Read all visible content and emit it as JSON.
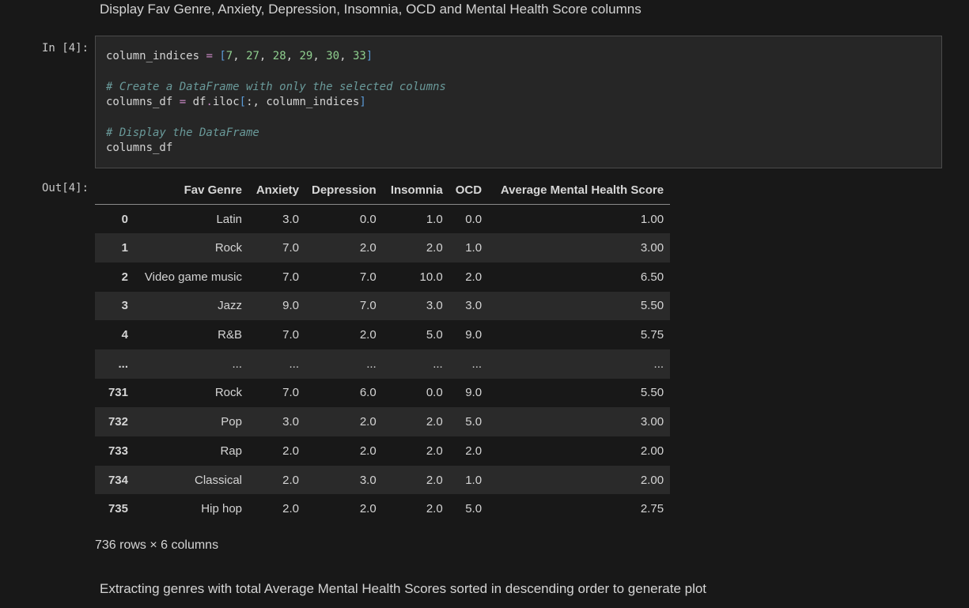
{
  "markdown_top": "Display Fav Genre, Anxiety, Depression, Insomnia, OCD and Mental Health Score columns",
  "in_prompt": "In [4]:",
  "out_prompt": "Out[4]:",
  "code": {
    "line1": {
      "var": "column_indices",
      "op": "=",
      "open": "[",
      "nums": [
        "7",
        "27",
        "28",
        "29",
        "30",
        "33"
      ],
      "sep": ", ",
      "close": "]"
    },
    "line2_comment": "# Create a DataFrame with only the selected columns",
    "line3": {
      "var": "columns_df",
      "op": "=",
      "obj": "df",
      "dot": ".",
      "method": "iloc",
      "open": "[",
      "slice": ":",
      "comma": ", ",
      "arg": "column_indices",
      "close": "]"
    },
    "line4_comment": "# Display the DataFrame",
    "line5": "columns_df"
  },
  "table": {
    "headers": [
      "",
      "Fav Genre",
      "Anxiety",
      "Depression",
      "Insomnia",
      "OCD",
      "Average Mental Health Score"
    ],
    "rows": [
      [
        "0",
        "Latin",
        "3.0",
        "0.0",
        "1.0",
        "0.0",
        "1.00"
      ],
      [
        "1",
        "Rock",
        "7.0",
        "2.0",
        "2.0",
        "1.0",
        "3.00"
      ],
      [
        "2",
        "Video game music",
        "7.0",
        "7.0",
        "10.0",
        "2.0",
        "6.50"
      ],
      [
        "3",
        "Jazz",
        "9.0",
        "7.0",
        "3.0",
        "3.0",
        "5.50"
      ],
      [
        "4",
        "R&B",
        "7.0",
        "2.0",
        "5.0",
        "9.0",
        "5.75"
      ],
      [
        "...",
        "...",
        "...",
        "...",
        "...",
        "...",
        "..."
      ],
      [
        "731",
        "Rock",
        "7.0",
        "6.0",
        "0.0",
        "9.0",
        "5.50"
      ],
      [
        "732",
        "Pop",
        "3.0",
        "2.0",
        "2.0",
        "5.0",
        "3.00"
      ],
      [
        "733",
        "Rap",
        "2.0",
        "2.0",
        "2.0",
        "2.0",
        "2.00"
      ],
      [
        "734",
        "Classical",
        "2.0",
        "3.0",
        "2.0",
        "1.0",
        "2.00"
      ],
      [
        "735",
        "Hip hop",
        "2.0",
        "2.0",
        "2.0",
        "5.0",
        "2.75"
      ]
    ]
  },
  "shape_text": "736 rows × 6 columns",
  "markdown_bottom": "Extracting genres with total Average Mental Health Scores sorted in descending order to generate plot"
}
